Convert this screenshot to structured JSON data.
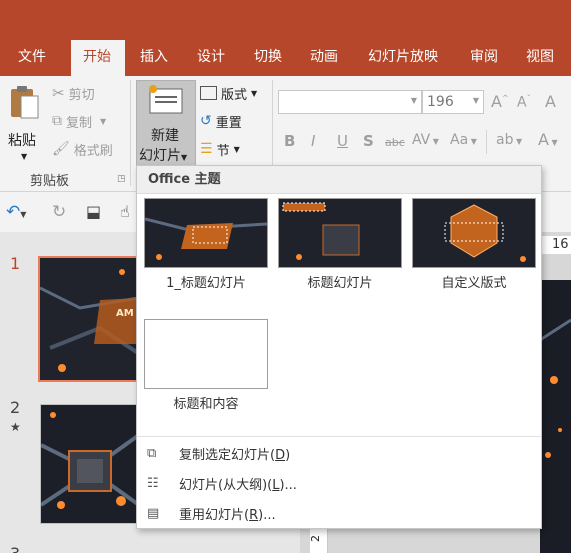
{
  "colors": {
    "accent": "#b7472a",
    "ribbon_bg": "#f3f3f3"
  },
  "tabs": [
    {
      "label": "文件"
    },
    {
      "label": "开始"
    },
    {
      "label": "插入"
    },
    {
      "label": "设计"
    },
    {
      "label": "切换"
    },
    {
      "label": "动画"
    },
    {
      "label": "幻灯片放映"
    },
    {
      "label": "审阅"
    },
    {
      "label": "视图"
    }
  ],
  "ribbon": {
    "paste_label": "粘贴",
    "cut_label": "剪切",
    "copy_label": "复制",
    "format_painter_label": "格式刷",
    "clipboard_group": "剪贴板",
    "new_slide_line1": "新建",
    "new_slide_line2": "幻灯片",
    "layout_label": "版式",
    "reset_label": "重置",
    "section_label": "节",
    "font_size": "196",
    "font_buttons": [
      "B",
      "I",
      "U",
      "S",
      "abc",
      "AV",
      "Aa"
    ]
  },
  "qat": {
    "ruler_number": "16"
  },
  "slides": [
    {
      "number": "1"
    },
    {
      "number": "2",
      "star": "★"
    }
  ],
  "dropdown": {
    "header": "Office 主题",
    "layouts": [
      {
        "label": "1_标题幻灯片"
      },
      {
        "label": "标题幻灯片"
      },
      {
        "label": "自定义版式"
      },
      {
        "label": "标题和内容"
      }
    ],
    "dup_prefix": "复制选定幻灯片(",
    "dup_key": "D",
    "dup_suffix": ")",
    "outline_prefix": "幻灯片(从大纲)(",
    "outline_key": "L",
    "outline_suffix": ")...",
    "reuse_prefix": "重用幻灯片(",
    "reuse_key": "R",
    "reuse_suffix": ")..."
  }
}
